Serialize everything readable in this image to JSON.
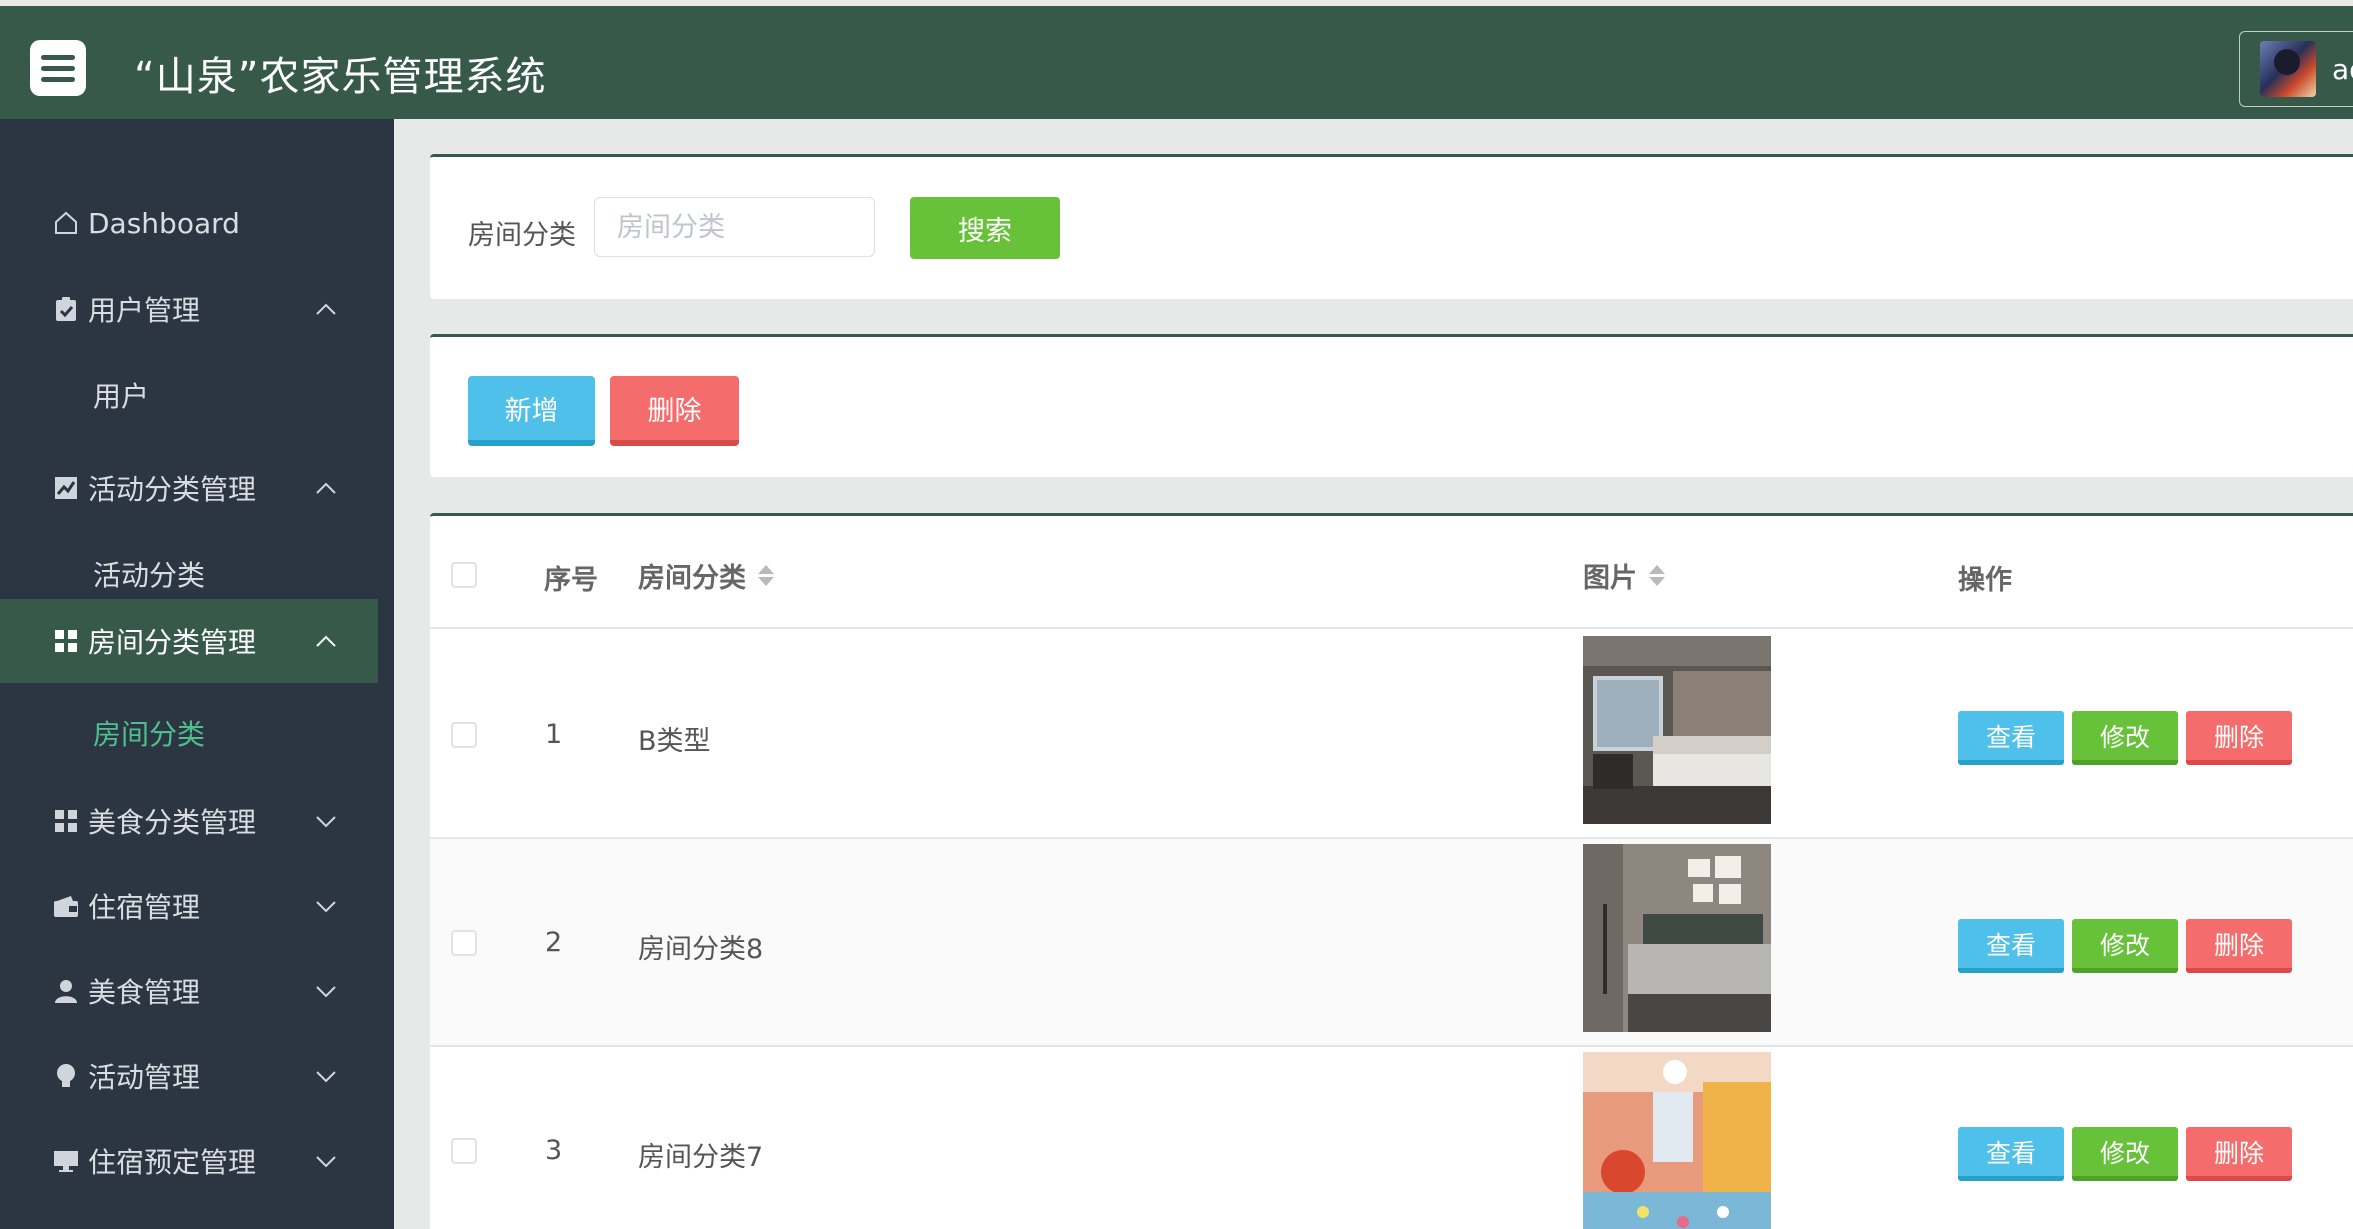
{
  "header": {
    "title": "“山泉”农家乐管理系统",
    "user_name": "ad"
  },
  "sidebar": {
    "items": [
      {
        "label": "Dashboard",
        "icon": "home-icon"
      },
      {
        "label": "用户管理",
        "icon": "clipboard-icon"
      },
      {
        "label": "用户"
      },
      {
        "label": "活动分类管理",
        "icon": "chart-icon"
      },
      {
        "label": "活动分类"
      },
      {
        "label": "房间分类管理",
        "icon": "grid-icon"
      },
      {
        "label": "房间分类"
      },
      {
        "label": "美食分类管理",
        "icon": "grid-icon"
      },
      {
        "label": "住宿管理",
        "icon": "wallet-icon"
      },
      {
        "label": "美食管理",
        "icon": "user-icon"
      },
      {
        "label": "活动管理",
        "icon": "bulb-icon"
      },
      {
        "label": "住宿预定管理",
        "icon": "monitor-icon"
      }
    ]
  },
  "search": {
    "label": "房间分类",
    "placeholder": "房间分类",
    "value": "",
    "button": "搜索"
  },
  "actions": {
    "add": "新增",
    "delete": "删除"
  },
  "table": {
    "columns": {
      "index": "序号",
      "category": "房间分类",
      "image": "图片",
      "operation": "操作"
    },
    "rows": [
      {
        "index": "1",
        "category": "B类型"
      },
      {
        "index": "2",
        "category": "房间分类8"
      },
      {
        "index": "3",
        "category": "房间分类7"
      }
    ],
    "row_buttons": {
      "view": "查看",
      "edit": "修改",
      "delete": "删除"
    }
  },
  "colors": {
    "header_bg": "#37594a",
    "sidebar_bg": "#2b3642",
    "active_sub": "#4fc08d",
    "primary_blue": "#4ec0e9",
    "success_green": "#67c23a",
    "danger_red": "#f56c6c"
  }
}
